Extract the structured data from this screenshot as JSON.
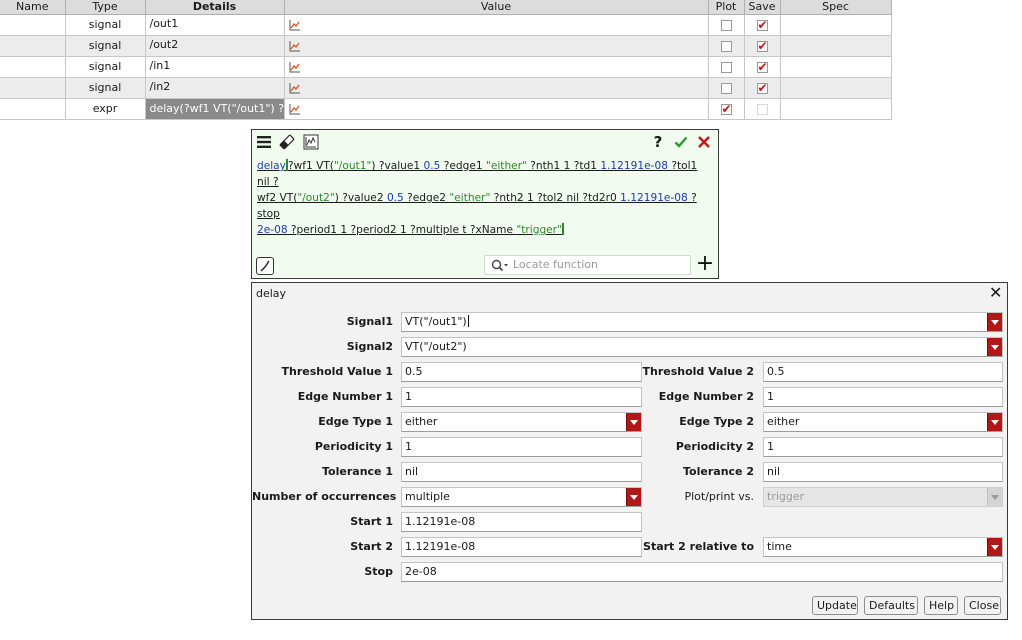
{
  "table": {
    "headers": [
      "Name",
      "Type",
      "Details",
      "Value",
      "Plot",
      "Save",
      "Spec"
    ],
    "rows": [
      {
        "name": "",
        "type": "signal",
        "details": "/out1",
        "value_icon": "waveform-icon",
        "plot": false,
        "save": true
      },
      {
        "name": "",
        "type": "signal",
        "details": "/out2",
        "value_icon": "waveform-icon",
        "plot": false,
        "save": true
      },
      {
        "name": "",
        "type": "signal",
        "details": "/in1",
        "value_icon": "waveform-icon",
        "plot": false,
        "save": true
      },
      {
        "name": "",
        "type": "signal",
        "details": "/in2",
        "value_icon": "waveform-icon",
        "plot": false,
        "save": true
      },
      {
        "name": "",
        "type": "expr",
        "details": "delay(?wf1 VT(\"/out1\") ?...",
        "value_icon": "waveform-icon",
        "plot": true,
        "save": false
      }
    ]
  },
  "calculator": {
    "toolbar_icons": [
      "menu-icon",
      "eraser-icon",
      "waveform-tool-icon",
      "help-icon",
      "accept-check-icon",
      "cancel-x-icon"
    ],
    "help_label": "?",
    "expression": {
      "fn": "delay",
      "p1": "?wf1 VT(",
      "s1": "\"/out1\"",
      "p2": ") ?value1 ",
      "n1": "0.5",
      "p3": " ?edge1 ",
      "s2": "\"either\"",
      "p4": " ?nth1 1 ?td1 ",
      "n2": "1.12191e-08",
      "p5": " ?tol1 nil ?",
      "p6": "wf2 VT(",
      "s3": "\"/out2\"",
      "p7": ") ?value2 ",
      "n3": "0.5",
      "p8": " ?edge2 ",
      "s4": "\"either\"",
      "p9": " ?nth2 1 ?tol2 nil ?td2r0 ",
      "n4": "1.12191e-08",
      "p10": " ?stop",
      "n5": "2e-08",
      "p11": " ?period1 1 ?period2 1 ?multiple t ?xName ",
      "s5": "\"trigger\""
    },
    "locate_placeholder": "Locate function"
  },
  "form": {
    "title": "delay",
    "signal1_label": "Signal1",
    "signal1_value": "VT(\"/out1\")",
    "signal2_label": "Signal2",
    "signal2_value": "VT(\"/out2\")",
    "threshold1_label": "Threshold Value 1",
    "threshold1_value": "0.5",
    "threshold2_label": "Threshold Value 2",
    "threshold2_value": "0.5",
    "edge_number1_label": "Edge Number 1",
    "edge_number1_value": "1",
    "edge_number2_label": "Edge Number 2",
    "edge_number2_value": "1",
    "edge_type1_label": "Edge Type 1",
    "edge_type1_value": "either",
    "edge_type2_label": "Edge Type 2",
    "edge_type2_value": "either",
    "periodicity1_label": "Periodicity 1",
    "periodicity1_value": "1",
    "periodicity2_label": "Periodicity 2",
    "periodicity2_value": "1",
    "tolerance1_label": "Tolerance 1",
    "tolerance1_value": "nil",
    "tolerance2_label": "Tolerance 2",
    "tolerance2_value": "nil",
    "occurrences_label": "Number of occurrences",
    "occurrences_value": "multiple",
    "plot_vs_label": "Plot/print vs.",
    "plot_vs_value": "trigger",
    "start1_label": "Start 1",
    "start1_value": "1.12191e-08",
    "start2_label": "Start 2",
    "start2_value": "1.12191e-08",
    "start2_rel_label": "Start 2 relative to",
    "start2_rel_value": "time",
    "stop_label": "Stop",
    "stop_value": "2e-08",
    "buttons": {
      "update": "Update",
      "defaults": "Defaults",
      "help": "Help",
      "close": "Close"
    }
  },
  "colors": {
    "accent_red": "#b01818",
    "check_green": "#2a9a2a",
    "string_green": "#2a8a2a",
    "number_blue": "#1a3ab0",
    "selection_gray": "#8a8a8a"
  }
}
